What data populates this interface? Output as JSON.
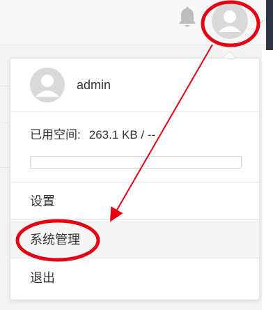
{
  "header": {
    "bell_icon": "bell-icon",
    "avatar_icon": "user-avatar-icon",
    "caret_icon": "chevron-down-icon"
  },
  "dropdown": {
    "user": {
      "avatar_icon": "user-avatar-icon",
      "name": "admin"
    },
    "storage": {
      "label": "已用空间:",
      "value": "263.1 KB / --",
      "usage_fraction": 0
    },
    "menu": [
      {
        "label": "设置"
      },
      {
        "label": "系统管理"
      },
      {
        "label": "退出"
      }
    ]
  },
  "annotations": {
    "color": "#e60012",
    "marks": [
      "header-avatar-circle",
      "system-management-circle",
      "arrow-avatar-to-system-management"
    ]
  }
}
